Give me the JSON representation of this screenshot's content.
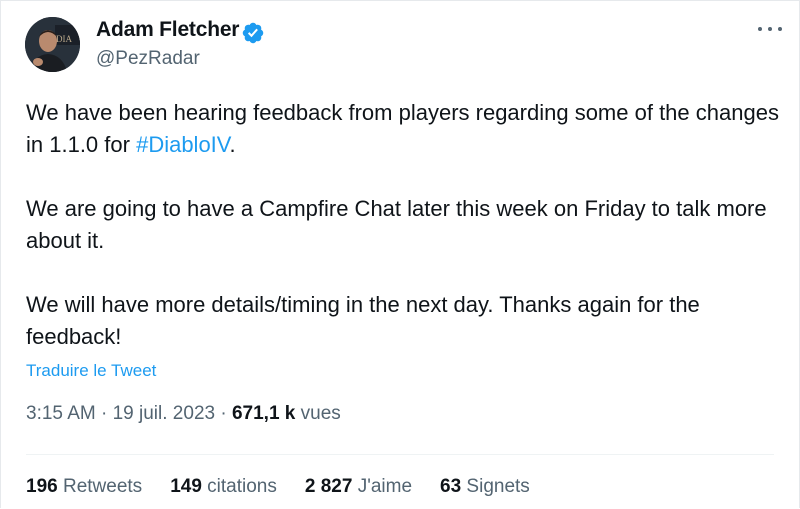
{
  "author": {
    "name": "Adam Fletcher",
    "handle": "@PezRadar",
    "verified_color": "#1d9bf0"
  },
  "tweet": {
    "line1_prefix": "We have been hearing feedback from players regarding some of the changes in 1.1.0 for ",
    "hashtag": "#DiabloIV",
    "line1_suffix": ".",
    "paragraph2": "We are going to have a Campfire Chat later this week on Friday to talk more about it.",
    "paragraph3": "We will have more details/timing in the next day. Thanks again for the feedback!"
  },
  "translate_label": "Traduire le Tweet",
  "meta": {
    "time": "3:15 AM",
    "separator1": " · ",
    "date": "19 juil. 2023",
    "separator2": " · ",
    "views_count": "671,1 k",
    "views_label": " vues"
  },
  "stats": {
    "retweets_count": "196",
    "retweets_label": " Retweets",
    "quotes_count": "149",
    "quotes_label": " citations",
    "likes_count": "2 827",
    "likes_label": " J'aime",
    "bookmarks_count": "63",
    "bookmarks_label": " Signets"
  },
  "colors": {
    "accent": "#1d9bf0",
    "text": "#0f1419",
    "muted": "#536471"
  },
  "icons": {
    "verified": "verified-badge-icon",
    "more": "more-options-icon"
  }
}
